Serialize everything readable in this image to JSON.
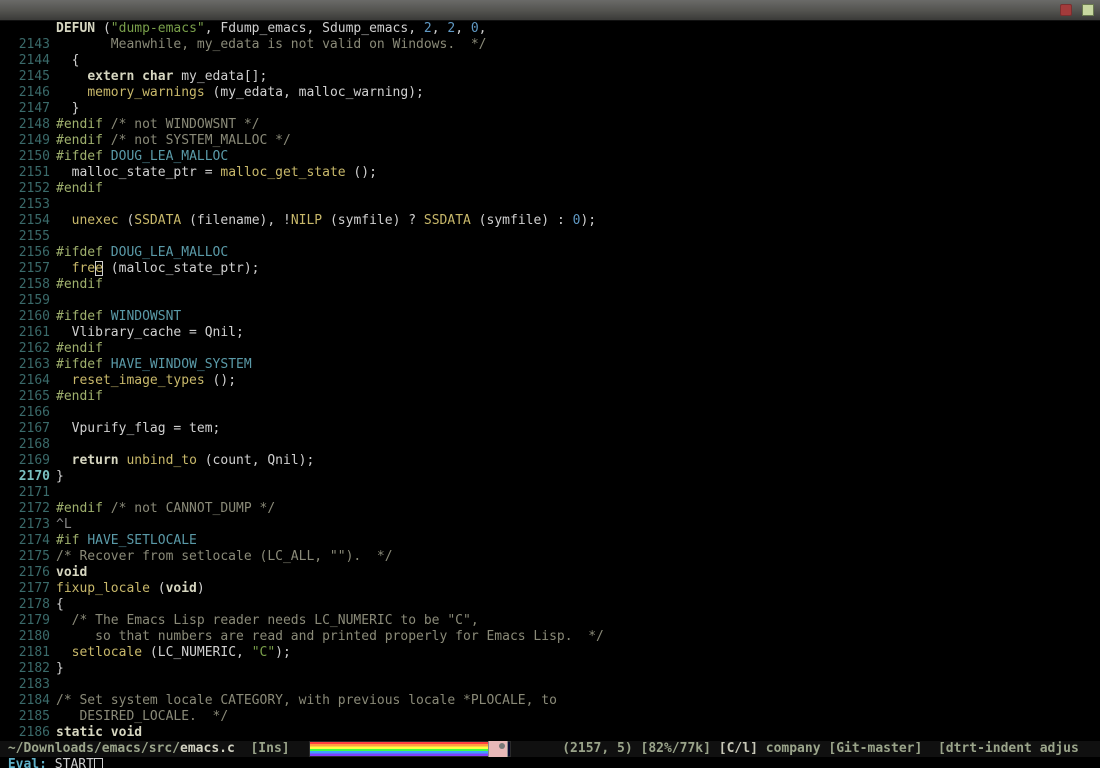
{
  "titlebar": {
    "close_icon": "close",
    "other_icon": "panel"
  },
  "header": {
    "segments": [
      {
        "t": "DEFUN",
        "cls": "kw"
      },
      {
        "t": " (",
        "cls": "txt"
      },
      {
        "t": "\"dump-emacs\"",
        "cls": "str"
      },
      {
        "t": ", Fdump_emacs, Sdump_emacs, ",
        "cls": "txt"
      },
      {
        "t": "2",
        "cls": "num"
      },
      {
        "t": ", ",
        "cls": "txt"
      },
      {
        "t": "2",
        "cls": "num"
      },
      {
        "t": ", ",
        "cls": "txt"
      },
      {
        "t": "0",
        "cls": "num"
      },
      {
        "t": ",",
        "cls": "txt"
      }
    ]
  },
  "lines": [
    {
      "n": 2143,
      "seg": [
        {
          "t": "       Meanwhile, my_edata is not valid on Windows.  */",
          "cls": "cmt"
        }
      ]
    },
    {
      "n": 2144,
      "seg": [
        {
          "t": "  {",
          "cls": "txt"
        }
      ]
    },
    {
      "n": 2145,
      "seg": [
        {
          "t": "    ",
          "cls": "txt"
        },
        {
          "t": "extern char",
          "cls": "kw"
        },
        {
          "t": " my_edata[];",
          "cls": "txt"
        }
      ]
    },
    {
      "n": 2146,
      "seg": [
        {
          "t": "    ",
          "cls": "txt"
        },
        {
          "t": "memory_warnings",
          "cls": "fn"
        },
        {
          "t": " (my_edata, malloc_warning);",
          "cls": "txt"
        }
      ]
    },
    {
      "n": 2147,
      "seg": [
        {
          "t": "  }",
          "cls": "txt"
        }
      ]
    },
    {
      "n": 2148,
      "seg": [
        {
          "t": "#endif",
          "cls": "pp"
        },
        {
          "t": " /* not WINDOWSNT */",
          "cls": "cmt"
        }
      ]
    },
    {
      "n": 2149,
      "seg": [
        {
          "t": "#endif",
          "cls": "pp"
        },
        {
          "t": " /* not SYSTEM_MALLOC */",
          "cls": "cmt"
        }
      ]
    },
    {
      "n": 2150,
      "seg": [
        {
          "t": "#ifdef",
          "cls": "pp"
        },
        {
          "t": " ",
          "cls": "txt"
        },
        {
          "t": "DOUG_LEA_MALLOC",
          "cls": "sym"
        }
      ]
    },
    {
      "n": 2151,
      "seg": [
        {
          "t": "  malloc_state_ptr = ",
          "cls": "txt"
        },
        {
          "t": "malloc_get_state",
          "cls": "fn"
        },
        {
          "t": " ();",
          "cls": "txt"
        }
      ]
    },
    {
      "n": 2152,
      "seg": [
        {
          "t": "#endif",
          "cls": "pp"
        }
      ]
    },
    {
      "n": 2153,
      "seg": [
        {
          "t": "",
          "cls": "txt"
        }
      ]
    },
    {
      "n": 2154,
      "seg": [
        {
          "t": "  ",
          "cls": "txt"
        },
        {
          "t": "unexec",
          "cls": "fn"
        },
        {
          "t": " (",
          "cls": "txt"
        },
        {
          "t": "SSDATA",
          "cls": "fn"
        },
        {
          "t": " (filename), !",
          "cls": "txt"
        },
        {
          "t": "NILP",
          "cls": "fn"
        },
        {
          "t": " (symfile) ? ",
          "cls": "txt"
        },
        {
          "t": "SSDATA",
          "cls": "fn"
        },
        {
          "t": " (symfile) : ",
          "cls": "txt"
        },
        {
          "t": "0",
          "cls": "num"
        },
        {
          "t": ");",
          "cls": "txt"
        }
      ]
    },
    {
      "n": 2155,
      "seg": [
        {
          "t": "",
          "cls": "txt"
        }
      ]
    },
    {
      "n": 2156,
      "seg": [
        {
          "t": "#ifdef",
          "cls": "pp"
        },
        {
          "t": " ",
          "cls": "txt"
        },
        {
          "t": "DOUG_LEA_MALLOC",
          "cls": "sym"
        }
      ]
    },
    {
      "n": 2157,
      "seg": [
        {
          "t": "  ",
          "cls": "txt"
        },
        {
          "t": "fre",
          "cls": "fn"
        },
        {
          "t": "e",
          "cls": "fn",
          "cursor": true
        },
        {
          "t": " (malloc_state_ptr);",
          "cls": "txt"
        }
      ]
    },
    {
      "n": 2158,
      "seg": [
        {
          "t": "#endif",
          "cls": "pp"
        }
      ]
    },
    {
      "n": 2159,
      "seg": [
        {
          "t": "",
          "cls": "txt"
        }
      ]
    },
    {
      "n": 2160,
      "seg": [
        {
          "t": "#ifdef",
          "cls": "pp"
        },
        {
          "t": " ",
          "cls": "txt"
        },
        {
          "t": "WINDOWSNT",
          "cls": "sym"
        }
      ]
    },
    {
      "n": 2161,
      "seg": [
        {
          "t": "  Vlibrary_cache = Qnil;",
          "cls": "txt"
        }
      ]
    },
    {
      "n": 2162,
      "seg": [
        {
          "t": "#endif",
          "cls": "pp"
        }
      ]
    },
    {
      "n": 2163,
      "seg": [
        {
          "t": "#ifdef",
          "cls": "pp"
        },
        {
          "t": " ",
          "cls": "txt"
        },
        {
          "t": "HAVE_WINDOW_SYSTEM",
          "cls": "sym"
        }
      ]
    },
    {
      "n": 2164,
      "seg": [
        {
          "t": "  ",
          "cls": "txt"
        },
        {
          "t": "reset_image_types",
          "cls": "fn"
        },
        {
          "t": " ();",
          "cls": "txt"
        }
      ]
    },
    {
      "n": 2165,
      "seg": [
        {
          "t": "#endif",
          "cls": "pp"
        }
      ]
    },
    {
      "n": 2166,
      "seg": [
        {
          "t": "",
          "cls": "txt"
        }
      ]
    },
    {
      "n": 2167,
      "seg": [
        {
          "t": "  Vpurify_flag = tem;",
          "cls": "txt"
        }
      ]
    },
    {
      "n": 2168,
      "seg": [
        {
          "t": "",
          "cls": "txt"
        }
      ]
    },
    {
      "n": 2169,
      "seg": [
        {
          "t": "  ",
          "cls": "txt"
        },
        {
          "t": "return",
          "cls": "kw"
        },
        {
          "t": " ",
          "cls": "txt"
        },
        {
          "t": "unbind_to",
          "cls": "fn"
        },
        {
          "t": " (count, Qnil);",
          "cls": "txt"
        }
      ]
    },
    {
      "n": 2170,
      "hl": true,
      "seg": [
        {
          "t": "}",
          "cls": "txt"
        }
      ]
    },
    {
      "n": 2171,
      "seg": [
        {
          "t": "",
          "cls": "txt"
        }
      ]
    },
    {
      "n": 2172,
      "seg": [
        {
          "t": "#endif",
          "cls": "pp"
        },
        {
          "t": " /* not CANNOT_DUMP */",
          "cls": "cmt"
        }
      ]
    },
    {
      "n": 2173,
      "seg": [
        {
          "t": "^L",
          "cls": "ctrl"
        }
      ]
    },
    {
      "n": 2174,
      "seg": [
        {
          "t": "#if",
          "cls": "pp"
        },
        {
          "t": " ",
          "cls": "txt"
        },
        {
          "t": "HAVE_SETLOCALE",
          "cls": "sym"
        }
      ]
    },
    {
      "n": 2175,
      "seg": [
        {
          "t": "/* Recover from setlocale (LC_ALL, \"\").  */",
          "cls": "cmt"
        }
      ]
    },
    {
      "n": 2176,
      "seg": [
        {
          "t": "void",
          "cls": "kw"
        }
      ]
    },
    {
      "n": 2177,
      "seg": [
        {
          "t": "fixup_locale",
          "cls": "fn"
        },
        {
          "t": " (",
          "cls": "txt"
        },
        {
          "t": "void",
          "cls": "kw"
        },
        {
          "t": ")",
          "cls": "txt"
        }
      ]
    },
    {
      "n": 2178,
      "seg": [
        {
          "t": "{",
          "cls": "txt"
        }
      ]
    },
    {
      "n": 2179,
      "seg": [
        {
          "t": "  /* The Emacs Lisp reader needs LC_NUMERIC to be \"C\",",
          "cls": "cmt"
        }
      ]
    },
    {
      "n": 2180,
      "seg": [
        {
          "t": "     so that numbers are read and printed properly for Emacs Lisp.  */",
          "cls": "cmt"
        }
      ]
    },
    {
      "n": 2181,
      "seg": [
        {
          "t": "  ",
          "cls": "txt"
        },
        {
          "t": "setlocale",
          "cls": "fn"
        },
        {
          "t": " (LC_NUMERIC, ",
          "cls": "txt"
        },
        {
          "t": "\"C\"",
          "cls": "str"
        },
        {
          "t": ");",
          "cls": "txt"
        }
      ]
    },
    {
      "n": 2182,
      "seg": [
        {
          "t": "}",
          "cls": "txt"
        }
      ]
    },
    {
      "n": 2183,
      "seg": [
        {
          "t": "",
          "cls": "txt"
        }
      ]
    },
    {
      "n": 2184,
      "seg": [
        {
          "t": "/* Set system locale CATEGORY, with previous locale *PLOCALE, to",
          "cls": "cmt"
        }
      ]
    },
    {
      "n": 2185,
      "seg": [
        {
          "t": "   DESIRED_LOCALE.  */",
          "cls": "cmt"
        }
      ]
    },
    {
      "n": 2186,
      "seg": [
        {
          "t": "static void",
          "cls": "kw"
        }
      ]
    }
  ],
  "modeline": {
    "left_path": " ~/Downloads/emacs/src/",
    "filename": "emacs.c",
    "ins": "  [Ins]  ",
    "pos": "      (2157, 5) ",
    "pct": "[82%/77k] ",
    "mode": "[C/l] ",
    "minor": "company ",
    "vc": "[Git-master]  ",
    "tail": "[dtrt-indent adjus"
  },
  "minibuffer": {
    "prompt": "Eval: ",
    "input": "START"
  }
}
